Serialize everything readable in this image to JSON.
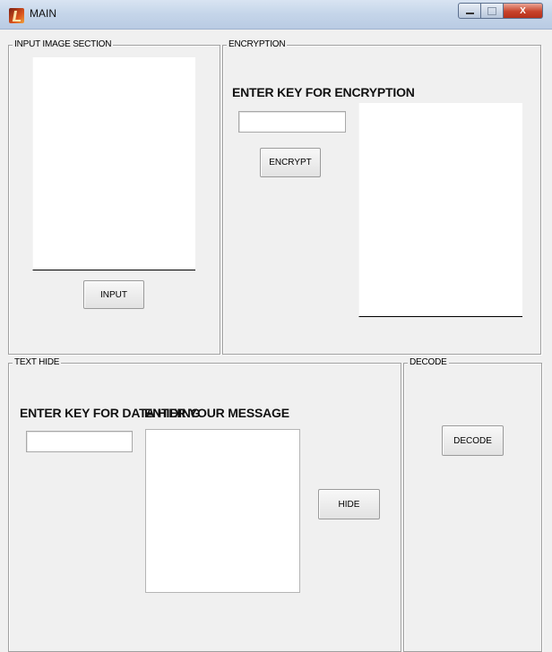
{
  "window": {
    "title": "MAIN",
    "icon": "matlab-icon",
    "minimize_glyph": "",
    "close_glyph": "X"
  },
  "panels": {
    "input_image": {
      "title": "INPUT IMAGE SECTION",
      "button": "INPUT"
    },
    "encryption": {
      "title": "ENCRYPTION",
      "key_label": "ENTER KEY FOR ENCRYPTION",
      "key_value": "",
      "button": "ENCRYPT"
    },
    "text_hide": {
      "title": "TEXT HIDE",
      "key_label": "ENTER KEY FOR DATA HIDING",
      "key_value": "",
      "message_label": "ENTER YOUR MESSAGE",
      "message_value": "",
      "button": "HIDE"
    },
    "decode": {
      "title": "DECODE",
      "button": "DECODE"
    }
  }
}
